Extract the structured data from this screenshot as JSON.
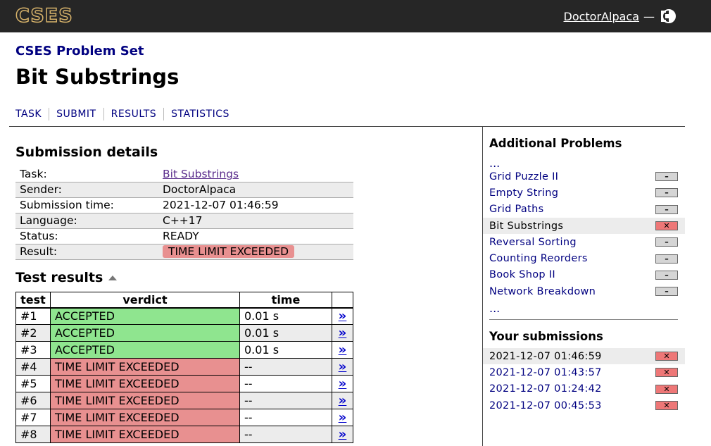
{
  "header": {
    "logo": "CSES",
    "username": "DoctorAlpaca",
    "dash": "—",
    "theme_icon": "half-circle-icon",
    "logout_icon": "logout-icon"
  },
  "site_title": "CSES Problem Set",
  "page_title": "Bit Substrings",
  "nav": [
    "TASK",
    "SUBMIT",
    "RESULTS",
    "STATISTICS"
  ],
  "details": {
    "heading": "Submission details",
    "rows": [
      {
        "label": "Task:",
        "value": "Bit Substrings"
      },
      {
        "label": "Sender:",
        "value": "DoctorAlpaca"
      },
      {
        "label": "Submission time:",
        "value": "2021-12-07 01:46:59"
      },
      {
        "label": "Language:",
        "value": "C++17"
      },
      {
        "label": "Status:",
        "value": "READY"
      },
      {
        "label": "Result:",
        "value": "TIME LIMIT EXCEEDED"
      }
    ]
  },
  "tests": {
    "heading": "Test results",
    "columns": [
      "test",
      "verdict",
      "time",
      ""
    ],
    "link_glyph": "»",
    "rows": [
      {
        "test": "#1",
        "verdict": "ACCEPTED",
        "time": "0.01 s"
      },
      {
        "test": "#2",
        "verdict": "ACCEPTED",
        "time": "0.01 s"
      },
      {
        "test": "#3",
        "verdict": "ACCEPTED",
        "time": "0.01 s"
      },
      {
        "test": "#4",
        "verdict": "TIME LIMIT EXCEEDED",
        "time": "--"
      },
      {
        "test": "#5",
        "verdict": "TIME LIMIT EXCEEDED",
        "time": "--"
      },
      {
        "test": "#6",
        "verdict": "TIME LIMIT EXCEEDED",
        "time": "--"
      },
      {
        "test": "#7",
        "verdict": "TIME LIMIT EXCEEDED",
        "time": "--"
      },
      {
        "test": "#8",
        "verdict": "TIME LIMIT EXCEEDED",
        "time": "--"
      }
    ]
  },
  "sidebar": {
    "problems_heading": "Additional Problems",
    "ellipsis": "...",
    "problems": [
      {
        "name": "Grid Puzzle II",
        "mark": "–",
        "state": "none"
      },
      {
        "name": "Empty String",
        "mark": "–",
        "state": "none"
      },
      {
        "name": "Grid Paths",
        "mark": "–",
        "state": "none"
      },
      {
        "name": "Bit Substrings",
        "mark": "✕",
        "state": "x"
      },
      {
        "name": "Reversal Sorting",
        "mark": "–",
        "state": "none"
      },
      {
        "name": "Counting Reorders",
        "mark": "–",
        "state": "none"
      },
      {
        "name": "Book Shop II",
        "mark": "–",
        "state": "none"
      },
      {
        "name": "Network Breakdown",
        "mark": "–",
        "state": "none"
      }
    ],
    "submissions_heading": "Your submissions",
    "submissions": [
      {
        "time": "2021-12-07 01:46:59",
        "mark": "✕"
      },
      {
        "time": "2021-12-07 01:43:57",
        "mark": "✕"
      },
      {
        "time": "2021-12-07 01:24:42",
        "mark": "✕"
      },
      {
        "time": "2021-12-07 00:45:53",
        "mark": "✕"
      }
    ]
  },
  "colors": {
    "header_bg": "#262626",
    "logo_gold": "#d6b26a",
    "accepted": "#8fe58f",
    "rejected": "#e89090",
    "link_navy": "#000080"
  }
}
